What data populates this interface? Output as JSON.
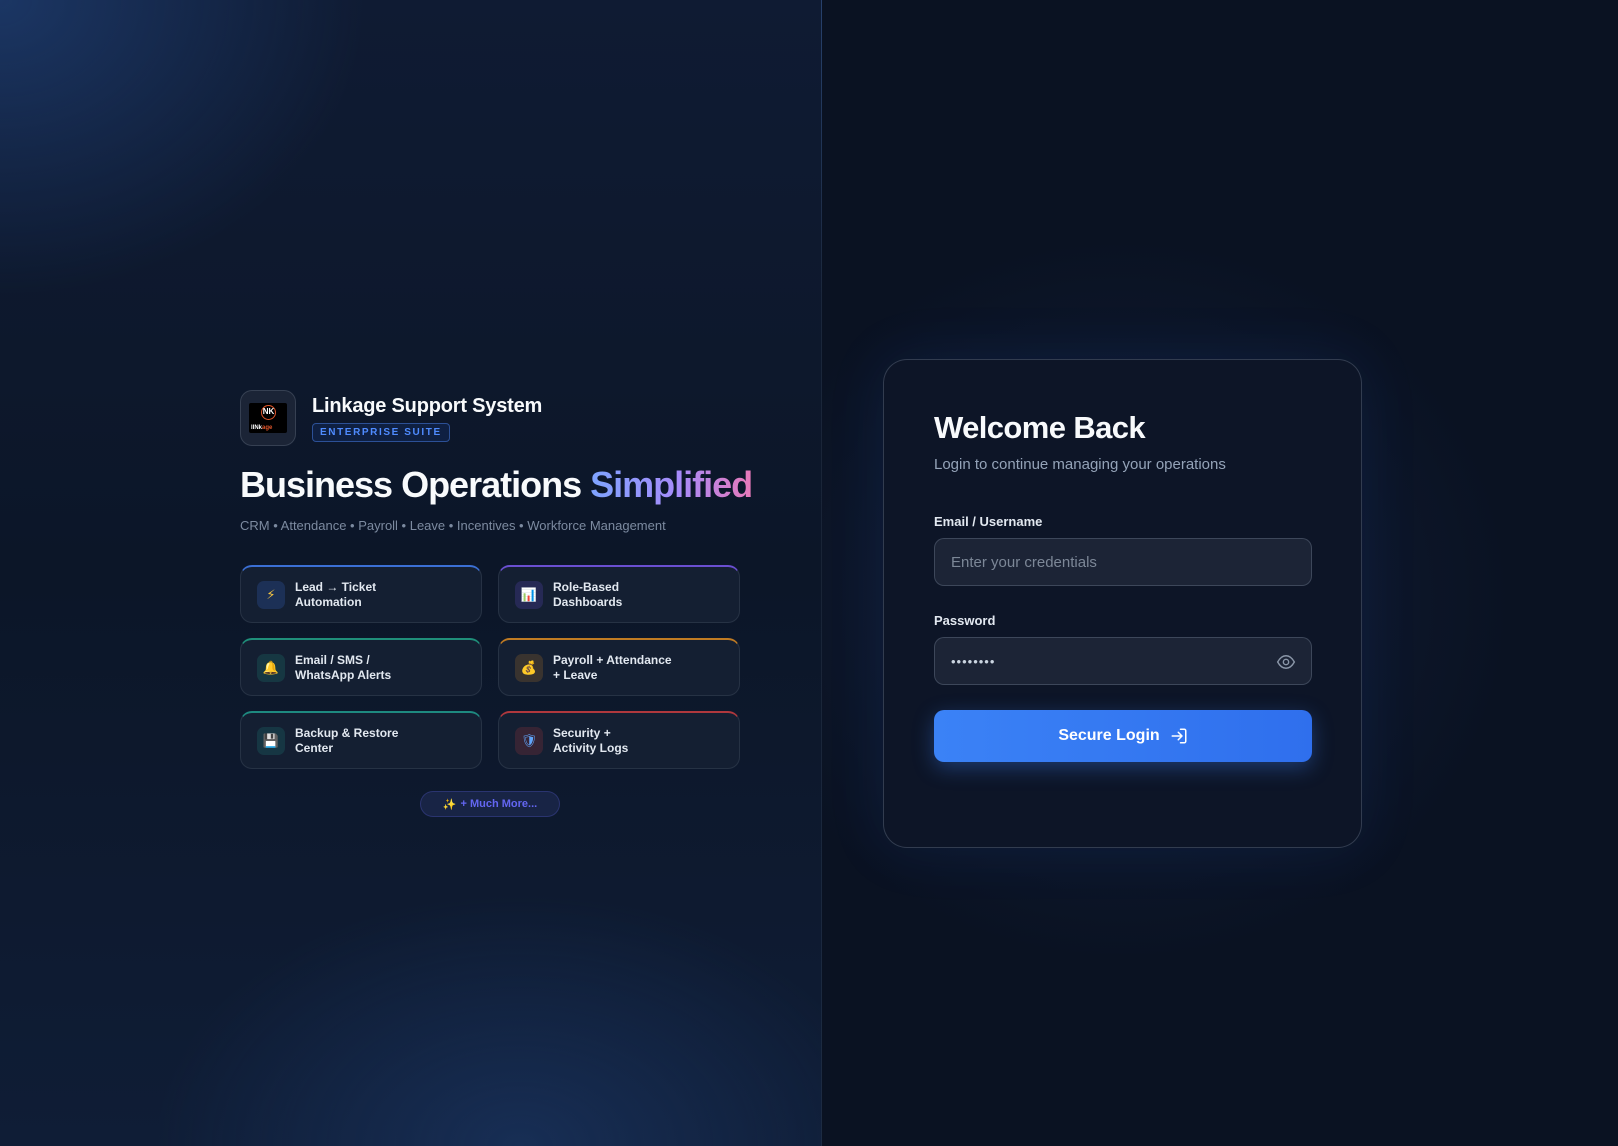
{
  "brand": {
    "title": "Linkage Support System",
    "badge": "ENTERPRISE SUITE",
    "logo_letters": "NK",
    "logo_word_a": "lINk",
    "logo_word_b": "age"
  },
  "hero": {
    "headline": "Business Operations",
    "headline_accent": "Simplified",
    "tagline": "CRM • Attendance • Payroll • Leave • Incentives • Workforce Management"
  },
  "features": [
    {
      "label": "Lead → Ticket\nAutomation",
      "icon": "⚡",
      "color": "#3b6fd4"
    },
    {
      "label": "Role-Based\nDashboards",
      "icon": "📊",
      "color": "#6a4fd1"
    },
    {
      "label": "Email / SMS /\nWhatsApp Alerts",
      "icon": "🔔",
      "color": "#1f8f7a"
    },
    {
      "label": "Payroll + Attendance\n+ Leave",
      "icon": "💰",
      "color": "#c07b23"
    },
    {
      "label": "Backup & Restore\nCenter",
      "icon": "💾",
      "color": "#1e8a80"
    },
    {
      "label": "Security +\nActivity Logs",
      "icon": "🛡",
      "color": "#b0383d"
    }
  ],
  "more_label": "+ Much More...",
  "more_icon": "✨",
  "login": {
    "title": "Welcome Back",
    "subtitle": "Login to continue managing your operations",
    "email_label": "Email / Username",
    "email_placeholder": "Enter your credentials",
    "password_label": "Password",
    "password_value": "••••••••",
    "button_label": "Secure Login"
  },
  "colors": {
    "accent": "#3b82f6",
    "badge": "#4f8bff"
  }
}
